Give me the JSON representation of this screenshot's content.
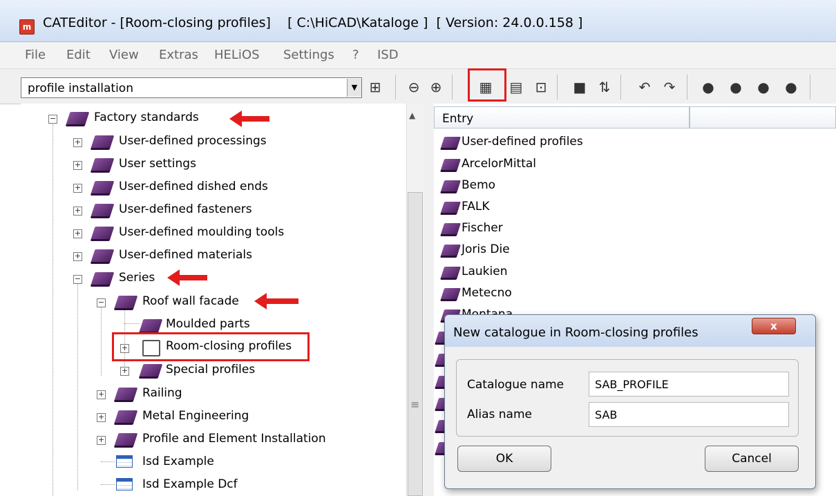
{
  "window": {
    "title": "CATEditor - [Room-closing profiles]    [ C:\\HiCAD\\Kataloge ]  [ Version: 24.0.0.158 ]",
    "app_icon": "cateditor-app-icon"
  },
  "menu": [
    "File",
    "Edit",
    "View",
    "Extras",
    "HELiOS",
    "Settings",
    "?",
    "ISD"
  ],
  "toolbar": {
    "search_value": "profile installation",
    "buttons": [
      "binoculars-icon",
      "back-icon",
      "forward-icon",
      "new-catalogue-icon",
      "document-icon",
      "table-insert-icon",
      "save-icon",
      "sort-icon",
      "undo-icon",
      "redo-icon",
      "add-book-icon",
      "add-book-icon",
      "add-book-icon",
      "remove-book-icon"
    ]
  },
  "tree": {
    "items": [
      {
        "label": "Factory standards",
        "icon": "book-icon",
        "expanded": true
      },
      {
        "label": "User-defined processings",
        "icon": "book-icon"
      },
      {
        "label": "User settings",
        "icon": "book-icon"
      },
      {
        "label": "User-defined dished ends",
        "icon": "book-icon"
      },
      {
        "label": "User-defined fasteners",
        "icon": "book-icon"
      },
      {
        "label": "User-defined moulding tools",
        "icon": "book-icon"
      },
      {
        "label": "User-defined materials",
        "icon": "book-icon"
      },
      {
        "label": "Series",
        "icon": "book-icon",
        "expanded": true
      },
      {
        "label": "Roof wall facade",
        "icon": "book-icon",
        "expanded": true
      },
      {
        "label": "Moulded parts",
        "icon": "book-icon"
      },
      {
        "label": "Room-closing profiles",
        "icon": "open-catalogue-icon",
        "selected": true
      },
      {
        "label": "Special profiles",
        "icon": "book-icon"
      },
      {
        "label": "Railing",
        "icon": "book-icon"
      },
      {
        "label": "Metal Engineering",
        "icon": "book-icon"
      },
      {
        "label": "Profile and Element Installation",
        "icon": "book-icon"
      },
      {
        "label": "Isd Example",
        "icon": "table-icon"
      },
      {
        "label": "Isd Example Dcf",
        "icon": "table-icon"
      }
    ]
  },
  "list": {
    "header": "Entry",
    "entries": [
      "User-defined profiles",
      "ArcelorMittal",
      "Bemo",
      "FALK",
      "Fischer",
      "Joris Die",
      "Laukien",
      "Metecno",
      "Montana"
    ]
  },
  "dialog": {
    "title": "New catalogue in Room-closing profiles",
    "close_label": "x",
    "catalogue_name_label": "Catalogue name",
    "catalogue_name_value": "SAB_PROFILE",
    "alias_name_label": "Alias name",
    "alias_name_value": "SAB",
    "ok_label": "OK",
    "cancel_label": "Cancel"
  },
  "colors": {
    "highlight": "#e21d1d",
    "book": "#5e2a78"
  }
}
